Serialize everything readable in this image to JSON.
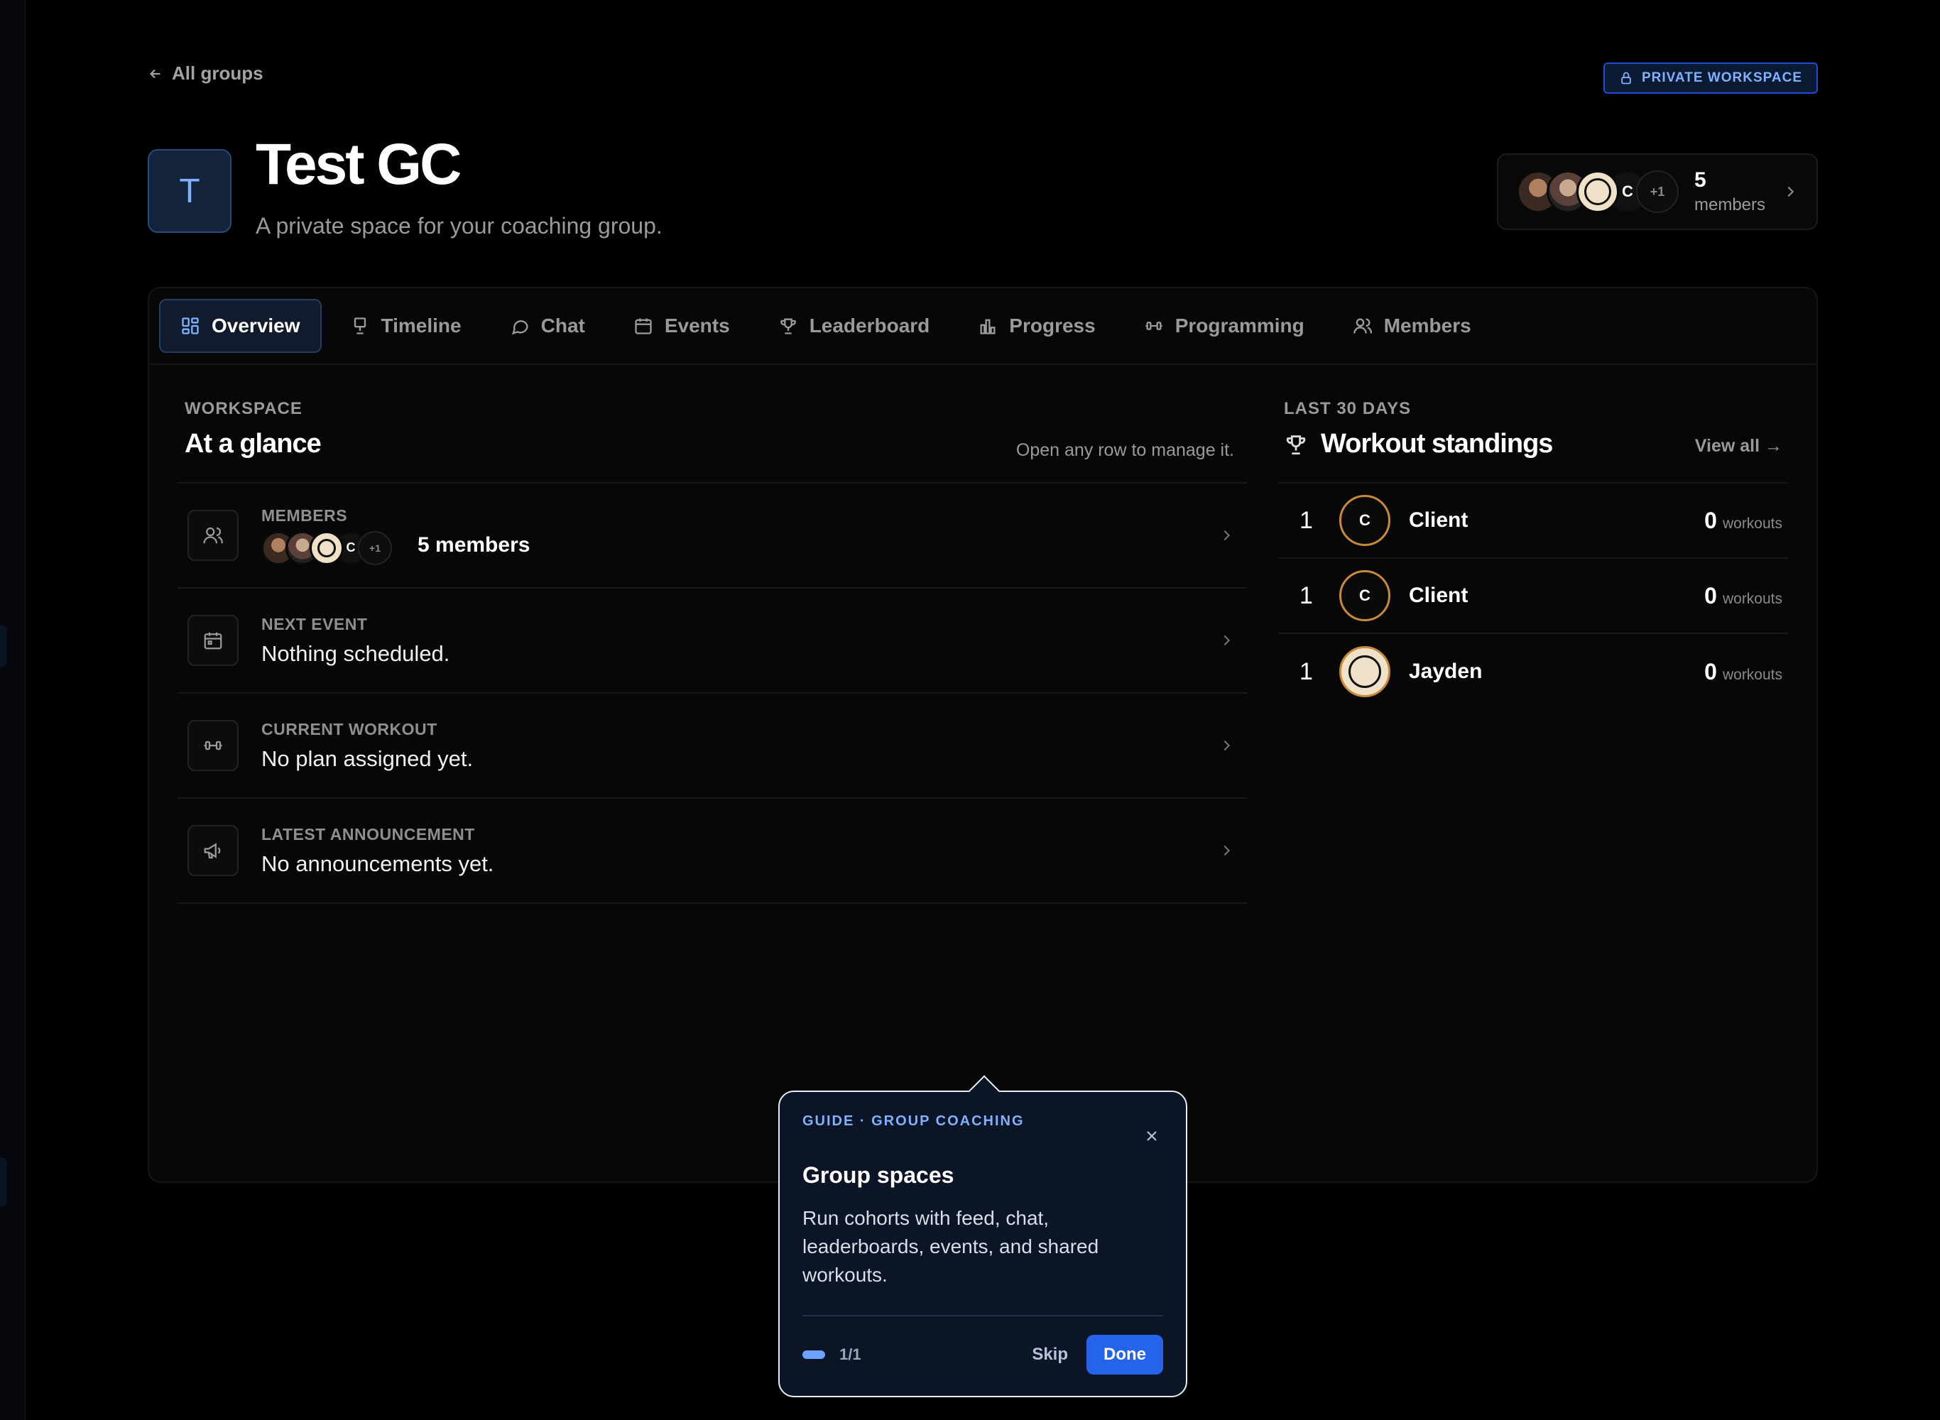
{
  "header": {
    "back_label": "All groups",
    "badge_label": "PRIVATE WORKSPACE",
    "group_initial": "T",
    "group_title": "Test GC",
    "group_subtitle": "A private space for your coaching group."
  },
  "members_card": {
    "avatars": [
      "photo",
      "photo",
      "logo",
      "C",
      "+1"
    ],
    "count": "5",
    "count_label": "members"
  },
  "tabs": [
    {
      "label": "Overview",
      "icon": "grid-icon",
      "active": true
    },
    {
      "label": "Timeline",
      "icon": "timeline-icon"
    },
    {
      "label": "Chat",
      "icon": "chat-bubble-icon"
    },
    {
      "label": "Events",
      "icon": "calendar-icon"
    },
    {
      "label": "Leaderboard",
      "icon": "trophy-icon"
    },
    {
      "label": "Progress",
      "icon": "bar-chart-icon"
    },
    {
      "label": "Programming",
      "icon": "dumbbell-icon"
    },
    {
      "label": "Members",
      "icon": "users-icon"
    }
  ],
  "glance": {
    "label": "WORKSPACE",
    "title": "At a glance",
    "hint": "Open any row to manage it.",
    "rows": [
      {
        "label": "MEMBERS",
        "value": "5 members",
        "icon": "users-icon"
      },
      {
        "label": "NEXT EVENT",
        "value": "Nothing scheduled.",
        "icon": "calendar-icon"
      },
      {
        "label": "CURRENT WORKOUT",
        "value": "No plan assigned yet.",
        "icon": "dumbbell-icon"
      },
      {
        "label": "LATEST ANNOUNCEMENT",
        "value": "No announcements yet.",
        "icon": "megaphone-icon"
      }
    ],
    "mini_avatars": {
      "letter": "C",
      "more": "+1"
    }
  },
  "standings": {
    "label": "LAST 30 DAYS",
    "title": "Workout standings",
    "view_all": "View all →",
    "rows": [
      {
        "rank": "1",
        "initial": "C",
        "name": "Client",
        "score": "0",
        "unit": "workouts"
      },
      {
        "rank": "1",
        "initial": "C",
        "name": "Client",
        "score": "0",
        "unit": "workouts"
      },
      {
        "rank": "1",
        "initial": "",
        "name": "Jayden",
        "score": "0",
        "unit": "workouts"
      }
    ]
  },
  "guide": {
    "kicker": "GUIDE · GROUP COACHING",
    "title": "Group spaces",
    "body": "Run cohorts with feed, chat, leaderboards, events, and shared workouts.",
    "step": "1/1",
    "skip_label": "Skip",
    "done_label": "Done"
  },
  "colors": {
    "accent": "#2563eb",
    "accent_light": "#7fb1ff",
    "avatar_ring": "#c8893a",
    "background": "#000000"
  }
}
